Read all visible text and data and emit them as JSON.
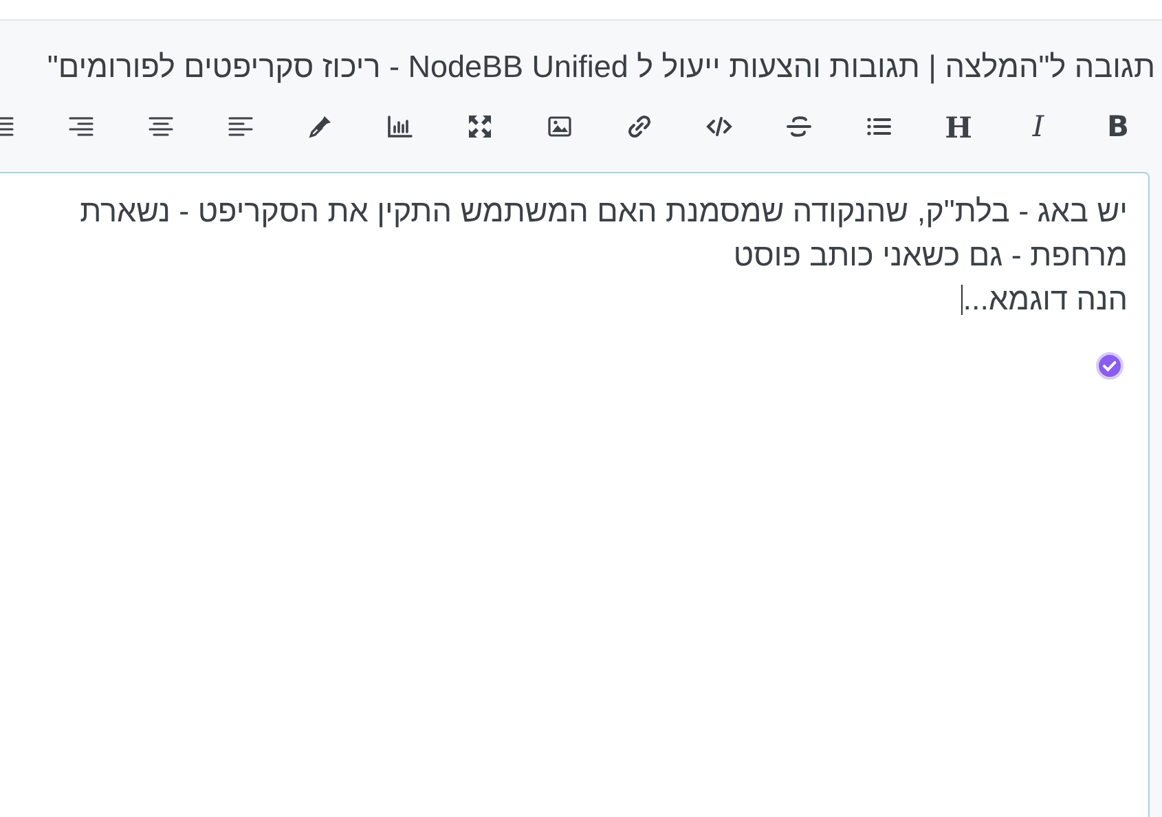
{
  "title": "תגובה ל\"המלצה | תגובות והצעות ייעול ל NodeBB Unified - ריכוז סקריפטים לפורומים\"",
  "toolbar": {
    "text_buttons": [
      {
        "label": "B"
      },
      {
        "label": "I"
      },
      {
        "label": "H"
      }
    ]
  },
  "editor": {
    "lines": [
      "יש באג - בלת\"ק, שהנקודה שמסמנת האם המשתמש התקין את הסקריפט - נשארת",
      "מרחפת - גם כשאני כותב פוסט",
      "הנה דוגמא..."
    ]
  }
}
